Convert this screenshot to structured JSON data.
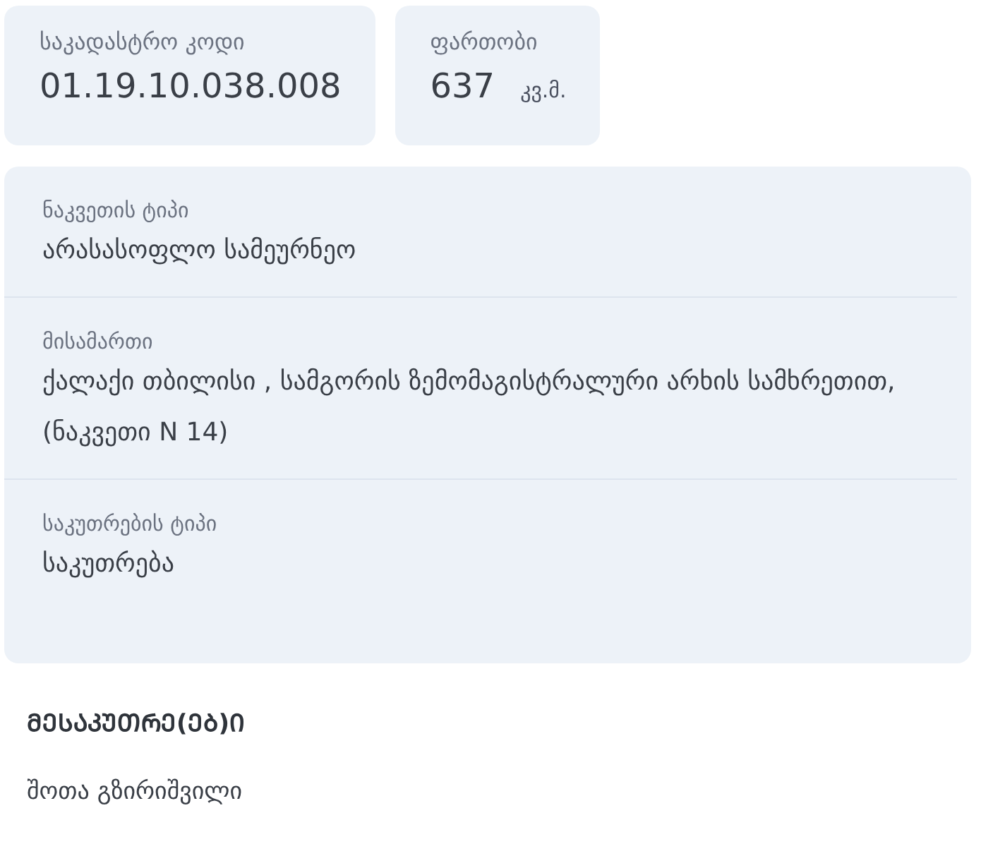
{
  "summary_cards": [
    {
      "label": "საკადასტრო კოდი",
      "value": "01.19.10.038.008"
    },
    {
      "label": "ფართობი",
      "value": "637",
      "unit": "კვ.მ."
    }
  ],
  "details": [
    {
      "label": "ნაკვეთის ტიპი",
      "value": "არასასოფლო სამეურნეო"
    },
    {
      "label": "მისამართი",
      "value": "ქალაქი თბილისი , სამგორის ზემომაგისტრალური არხის სამხრეთით, (ნაკვეთი N 14)"
    },
    {
      "label": "საკუთრების ტიპი",
      "value": "საკუთრება"
    }
  ],
  "owners": {
    "heading": "ᲛᲔᲡᲐᲙᲣᲗᲠᲔ(ᲔᲑ)Ი",
    "names": [
      "შოთა გზირიშვილი"
    ]
  }
}
